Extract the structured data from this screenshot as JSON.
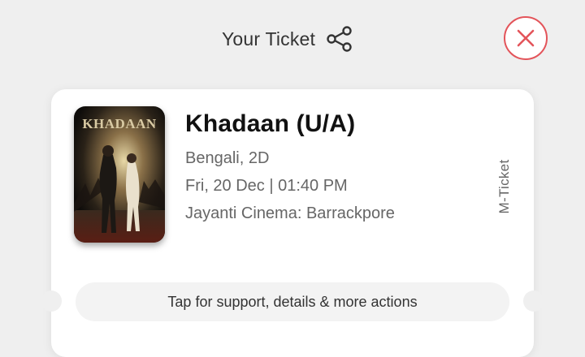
{
  "header": {
    "title": "Your Ticket",
    "share_icon": "share-icon",
    "close_icon": "close-icon"
  },
  "ticket": {
    "poster_title": "KHADAAN",
    "movie_title": "Khadaan (U/A)",
    "language_format": "Bengali, 2D",
    "showtime": "Fri, 20 Dec | 01:40 PM",
    "venue": "Jayanti Cinema: Barrackpore",
    "ticket_type": "M-Ticket",
    "support_text": "Tap for support, details & more actions"
  },
  "colors": {
    "background": "#efefef",
    "card": "#ffffff",
    "accent_red": "#e3545a",
    "support_bar": "#f3f3f3"
  }
}
